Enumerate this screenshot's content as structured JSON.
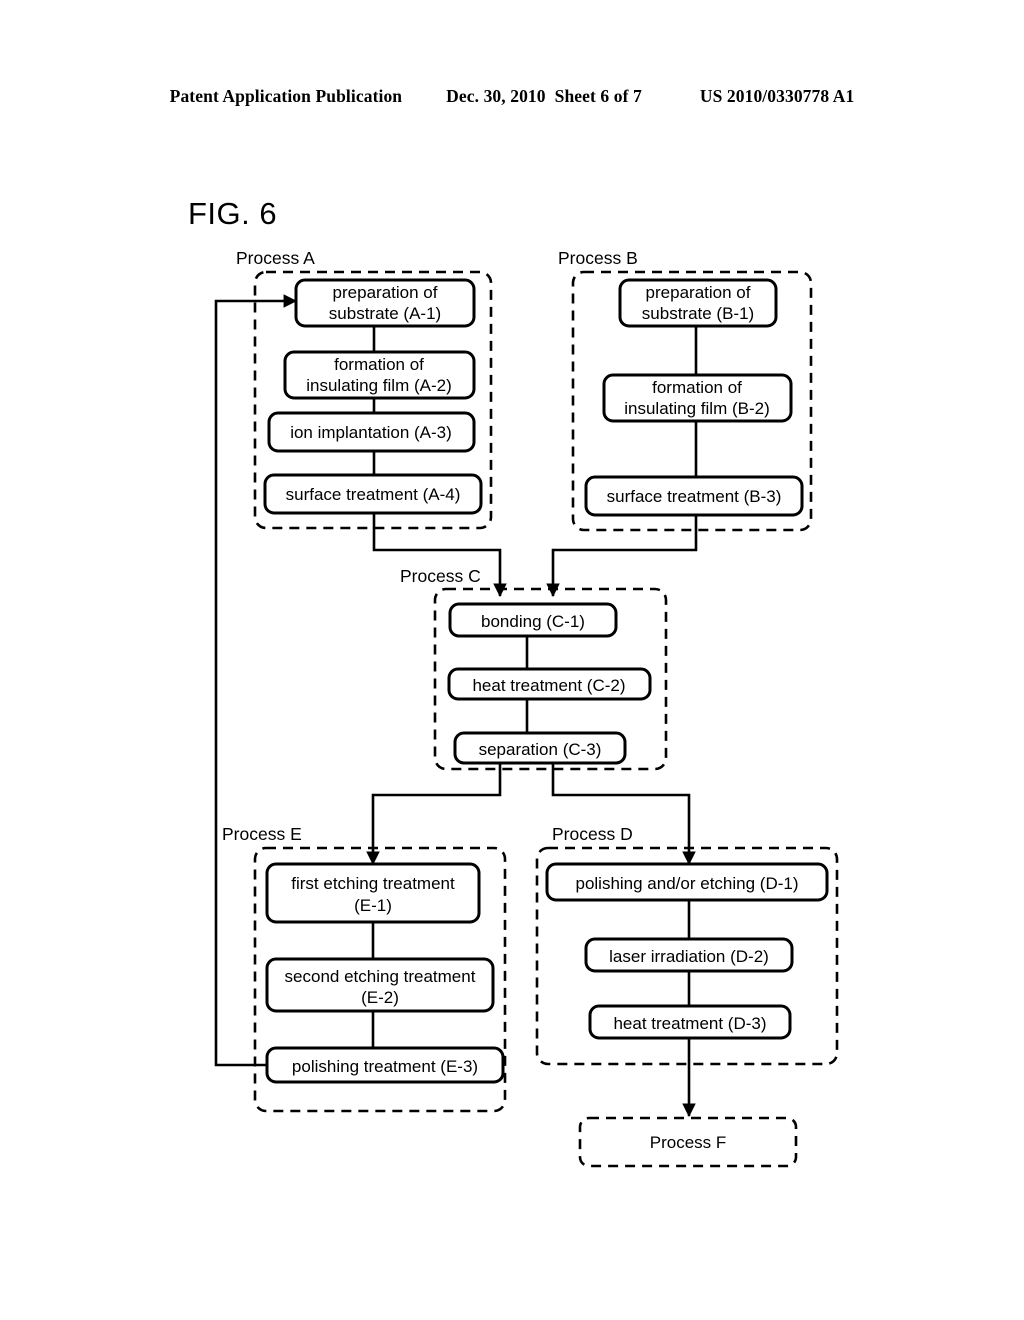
{
  "header": {
    "publication": "Patent Application Publication",
    "date": "Dec. 30, 2010",
    "sheet": "Sheet 6 of 7",
    "number": "US 2010/0330778 A1"
  },
  "figure": {
    "title": "FIG. 6",
    "groups": {
      "a": "Process A",
      "b": "Process B",
      "c": "Process C",
      "d": "Process D",
      "e": "Process E",
      "f": "Process F"
    },
    "nodes": {
      "a1_line1": "preparation of",
      "a1_line2": "substrate (A-1)",
      "a2_line1": "formation of",
      "a2_line2": "insulating film (A-2)",
      "a3": "ion implantation (A-3)",
      "a4": "surface treatment (A-4)",
      "b1_line1": "preparation of",
      "b1_line2": "substrate (B-1)",
      "b2_line1": "formation of",
      "b2_line2": "insulating film (B-2)",
      "b3": "surface treatment (B-3)",
      "c1": "bonding (C-1)",
      "c2": "heat treatment (C-2)",
      "c3": "separation (C-3)",
      "d1": "polishing and/or etching (D-1)",
      "d2": "laser irradiation (D-2)",
      "d3": "heat treatment (D-3)",
      "e1_line1": "first etching treatment",
      "e1_line2": "(E-1)",
      "e2_line1": "second etching treatment",
      "e2_line2": "(E-2)",
      "e3": "polishing treatment (E-3)"
    },
    "colors": {
      "ink": "#000000",
      "paper": "#ffffff"
    }
  }
}
